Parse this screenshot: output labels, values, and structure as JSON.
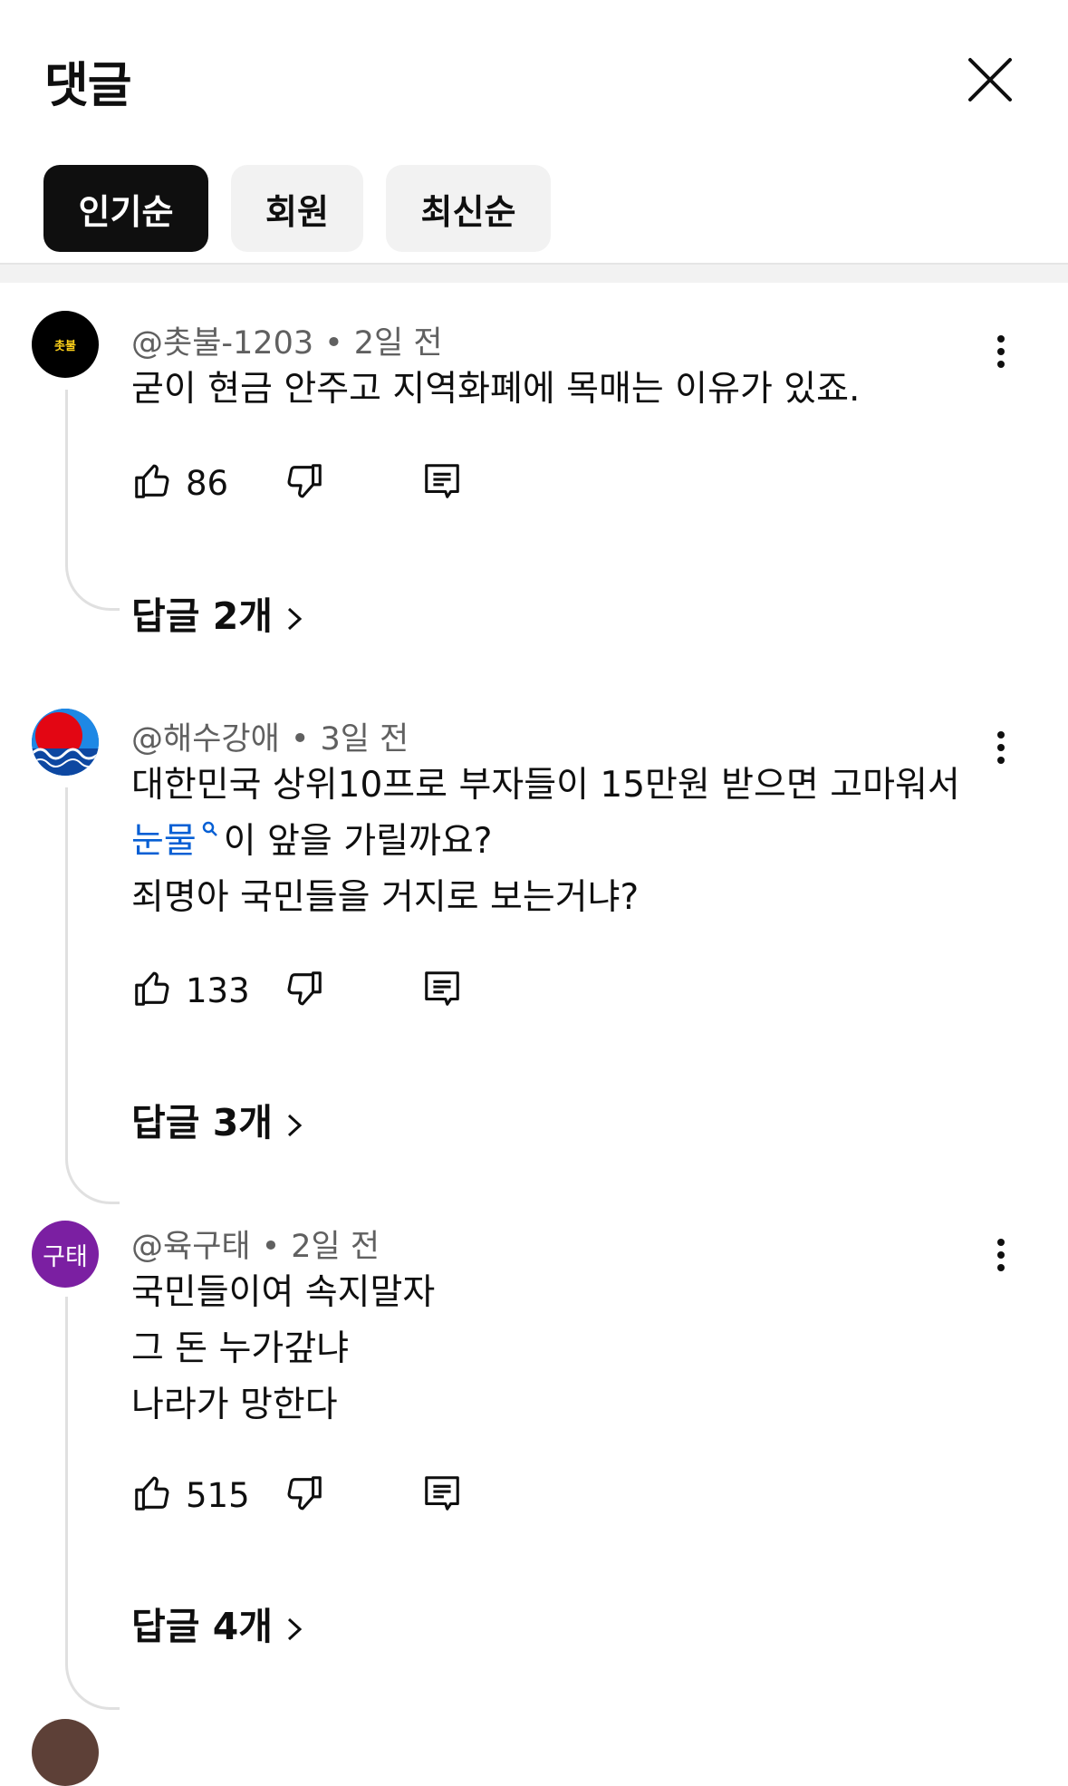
{
  "header": {
    "title": "댓글"
  },
  "tabs": [
    {
      "label": "인기순",
      "active": true
    },
    {
      "label": "회원",
      "active": false
    },
    {
      "label": "최신순",
      "active": false
    }
  ],
  "comments": [
    {
      "author": "@촛불-1203",
      "avatar_text": "촛불",
      "time": "2일 전",
      "lines": [
        "굳이 현금 안주고 지역화폐에 목매는 이유가 있죠."
      ],
      "likes": "86",
      "replies": "답글 2개"
    },
    {
      "author": "@해수강애",
      "time": "3일 전",
      "line1": "대한민국 상위10프로 부자들이 15만원 받으면 고마워서",
      "line2_link": "눈물",
      "line2_rest": "이 앞을 가릴까요?",
      "line3": "죄명아 국민들을 거지로 보는거냐?",
      "likes": "133",
      "replies": "답글 3개"
    },
    {
      "author": "@육구태",
      "avatar_text": "구태",
      "time": "2일 전",
      "lines": [
        "국민들이여 속지말자",
        "그 돈 누가갚냐",
        "나라가 망한다"
      ],
      "likes": "515",
      "replies": "답글 4개"
    }
  ],
  "colors": {
    "link": "#065fd4",
    "avatar3": "#7b1fa2",
    "chip_active": "#0f0f0f",
    "chip": "#f2f2f2"
  }
}
